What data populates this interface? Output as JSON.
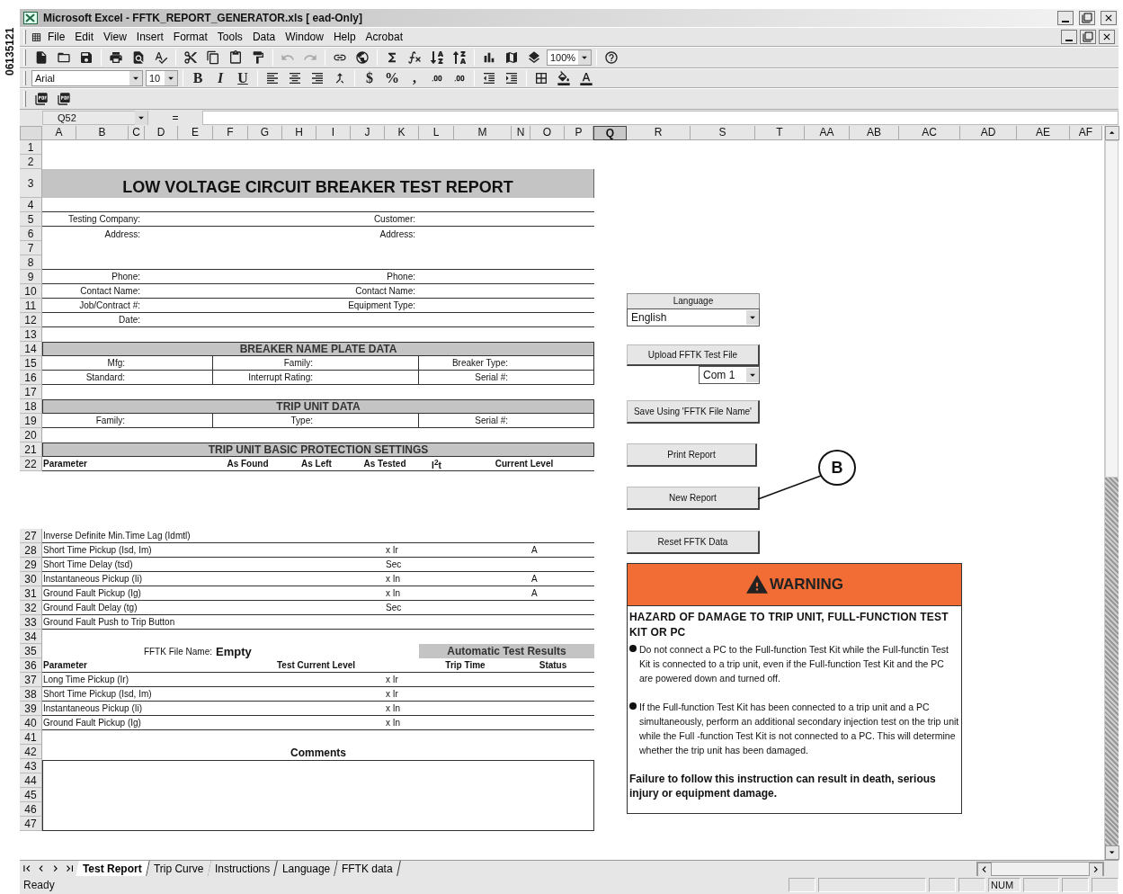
{
  "figure_number": "06135121",
  "window": {
    "title": "Microsoft Excel - FFTK_REPORT_GENERATOR.xls [ ead-Only]"
  },
  "menu": [
    "File",
    "Edit",
    "View",
    "Insert",
    "Format",
    "Tools",
    "Data",
    "Window",
    "Help",
    "Acrobat"
  ],
  "zoom": "100%",
  "formatting": {
    "font": "Arial",
    "size": "10",
    "bold": "B",
    "italic": "I",
    "underline": "U",
    "currency": "$",
    "percent": "%",
    "comma": ","
  },
  "name_box": "Q52",
  "formula_sign": "=",
  "columns": [
    {
      "label": "A",
      "selected": false
    },
    {
      "label": "B",
      "selected": false
    },
    {
      "label": "C",
      "selected": false
    },
    {
      "label": "D",
      "selected": false
    },
    {
      "label": "E",
      "selected": false
    },
    {
      "label": "F",
      "selected": false
    },
    {
      "label": "G",
      "selected": false
    },
    {
      "label": "H",
      "selected": false
    },
    {
      "label": "I",
      "selected": false
    },
    {
      "label": "J",
      "selected": false
    },
    {
      "label": "K",
      "selected": false
    },
    {
      "label": "L",
      "selected": false
    },
    {
      "label": "M",
      "selected": false
    },
    {
      "label": "N",
      "selected": false
    },
    {
      "label": "O",
      "selected": false
    },
    {
      "label": "P",
      "selected": false
    },
    {
      "label": "Q",
      "selected": true
    },
    {
      "label": "R",
      "selected": false
    },
    {
      "label": "S",
      "selected": false
    },
    {
      "label": "T",
      "selected": false
    },
    {
      "label": "AA",
      "selected": false
    },
    {
      "label": "AB",
      "selected": false
    },
    {
      "label": "AC",
      "selected": false
    },
    {
      "label": "AD",
      "selected": false
    },
    {
      "label": "AE",
      "selected": false
    },
    {
      "label": "AF",
      "selected": false
    }
  ],
  "report": [
    {
      "num": "1",
      "kind": "blank",
      "ruled": false
    },
    {
      "num": "2",
      "kind": "blank",
      "ruled": false
    },
    {
      "num": "3",
      "kind": "title",
      "text": "LOW VOLTAGE CIRCUIT BREAKER TEST REPORT"
    },
    {
      "num": "4",
      "kind": "blank",
      "ruled": true
    },
    {
      "num": "5",
      "kind": "pair",
      "labels": [
        "Testing Company:",
        "Customer:"
      ],
      "ruled": true
    },
    {
      "num": "6",
      "kind": "pair",
      "labels": [
        "Address:",
        "Address:"
      ],
      "ruled": false
    },
    {
      "num": "7",
      "kind": "blank",
      "ruled": false
    },
    {
      "num": "8",
      "kind": "blank",
      "ruled": true
    },
    {
      "num": "9",
      "kind": "pair",
      "labels": [
        "Phone:",
        "Phone:"
      ],
      "ruled": true
    },
    {
      "num": "10",
      "kind": "pair",
      "labels": [
        "Contact Name:",
        "Contact Name:"
      ],
      "ruled": true
    },
    {
      "num": "11",
      "kind": "pair",
      "labels": [
        "Job/Contract #:",
        "Equipment Type:"
      ],
      "ruled": true
    },
    {
      "num": "12",
      "kind": "pair",
      "labels": [
        "Date:"
      ],
      "ruled": true
    },
    {
      "num": "13",
      "kind": "blank",
      "ruled": false
    },
    {
      "num": "14",
      "kind": "section",
      "text": "BREAKER NAME PLATE DATA"
    },
    {
      "num": "15",
      "kind": "triple",
      "labels": [
        "Mfg:",
        "Family:",
        "Breaker Type:"
      ]
    },
    {
      "num": "16",
      "kind": "triple",
      "labels": [
        "Standard:",
        "Interrupt Rating:",
        "Serial #:"
      ]
    },
    {
      "num": "17",
      "kind": "blank",
      "ruled": false
    },
    {
      "num": "18",
      "kind": "section",
      "text": "TRIP UNIT DATA"
    },
    {
      "num": "19",
      "kind": "triple",
      "labels": [
        "Family:",
        "Type:",
        "Serial #:"
      ]
    },
    {
      "num": "20",
      "kind": "blank",
      "ruled": false
    },
    {
      "num": "21",
      "kind": "section",
      "text": "TRIP UNIT BASIC PROTECTION SETTINGS"
    },
    {
      "num": "22",
      "kind": "heading",
      "cells": [
        "Parameter",
        "As Found",
        "As Left",
        "As Tested",
        "I$^{2}$t",
        "Current Level"
      ]
    },
    {
      "kind": "hidden"
    },
    {
      "num": "27",
      "kind": "param",
      "label": "Inverse Definite Min.Time Lag (Idmtl)"
    },
    {
      "num": "28",
      "kind": "param",
      "label": "Short Time Pickup (Isd, Im)",
      "unit": "x Ir",
      "unit2": "A"
    },
    {
      "num": "29",
      "kind": "param",
      "label": "Short Time Delay (tsd)",
      "unit": "Sec"
    },
    {
      "num": "30",
      "kind": "param",
      "label": "Instantaneous Pickup (Ii)",
      "unit": "x In",
      "unit2": "A"
    },
    {
      "num": "31",
      "kind": "param",
      "label": "Ground Fault Pickup (Ig)",
      "unit": "x In",
      "unit2": "A"
    },
    {
      "num": "32",
      "kind": "param",
      "label": "Ground Fault Delay (tg)",
      "unit": "Sec"
    },
    {
      "num": "33",
      "kind": "param",
      "label": "Ground Fault Push to Trip Button"
    },
    {
      "num": "34",
      "kind": "blank",
      "ruled": false
    },
    {
      "num": "35",
      "kind": "file",
      "label": "FFTK File Name:",
      "value": "Empty",
      "results": "Automatic Test Results"
    },
    {
      "num": "36",
      "kind": "results_heading",
      "cells": [
        "Parameter",
        "Test Current Level",
        "Trip Time",
        "Status"
      ]
    },
    {
      "num": "37",
      "kind": "param",
      "label": "Long Time Pickup (Ir)",
      "unit": "x Ir"
    },
    {
      "num": "38",
      "kind": "param",
      "label": "Short Time Pickup (Isd, Im)",
      "unit": "x Ir"
    },
    {
      "num": "39",
      "kind": "param",
      "label": "Instantaneous Pickup (Ii)",
      "unit": "x In"
    },
    {
      "num": "40",
      "kind": "param",
      "label": "Ground Fault Pickup (Ig)",
      "unit": "x In"
    },
    {
      "num": "41",
      "kind": "blank",
      "ruled": false
    },
    {
      "num": "42",
      "kind": "caption",
      "text": "Comments"
    },
    {
      "kind": "comment_box",
      "nums": [
        "43",
        "44",
        "45",
        "46",
        "47"
      ]
    }
  ],
  "panel": {
    "language_label": "Language",
    "language": "English",
    "upload": "Upload FFTK Test File",
    "port": "Com 1",
    "save": "Save Using 'FFTK File Name'",
    "print": "Print Report",
    "new": "New Report",
    "reset": "Reset FFTK Data"
  },
  "callout": "B",
  "warning": {
    "title": "WARNING",
    "hazard": "HAZARD OF DAMAGE TO TRIP UNIT, FULL-FUNCTION TEST KIT OR PC",
    "bullets": [
      "Do not connect a PC to the Full-function Test Kit while the Full-functin Test Kit is connected to a trip unit, even if the Full-function Test Kit and the PC are powered down and turned off.",
      "If the Full-function Test Kit has been connected to a trip unit and a PC simultaneously, perform an additional secondary injection test on the trip unit while the Full -function Test Kit is not connected to a PC.  This will determine whether the trip unit has been damaged."
    ],
    "footer": "Failure to follow this instruction can result in death, serious injury or equipment damage."
  },
  "sheet_tabs": [
    {
      "label": "Test Report",
      "selected": true
    },
    {
      "label": "Trip Curve",
      "selected": false
    },
    {
      "label": "Instructions",
      "selected": false
    },
    {
      "label": "Language",
      "selected": false
    },
    {
      "label": "FFTK data",
      "selected": false
    }
  ],
  "status": {
    "mode": "Ready",
    "indicator": "NUM"
  }
}
